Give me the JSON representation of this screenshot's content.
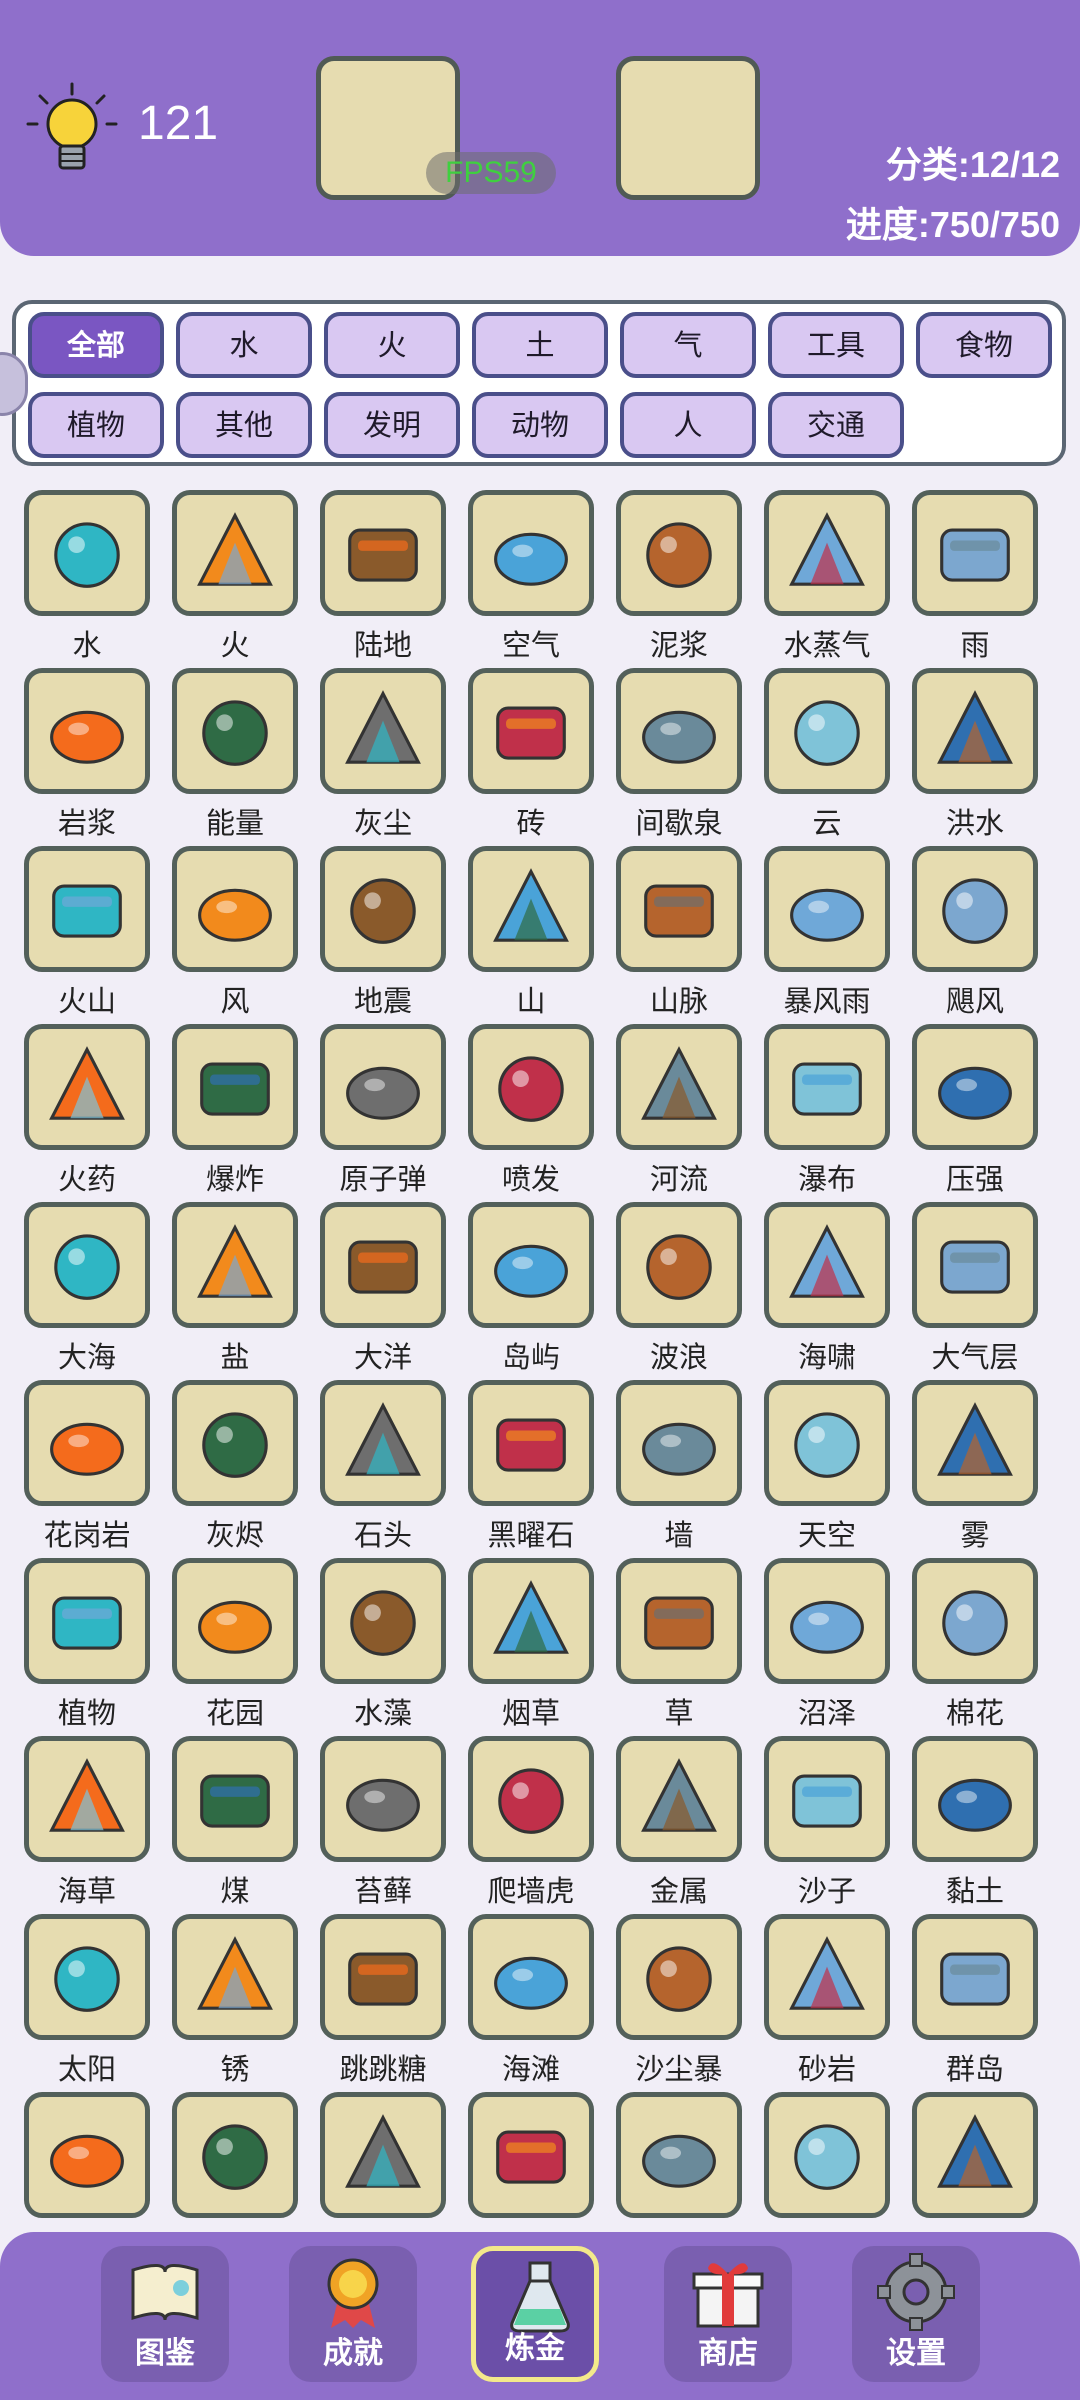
{
  "header": {
    "hint_count": "121",
    "fps": "FPS59",
    "category_stat": "分类:12/12",
    "progress_stat": "进度:750/750"
  },
  "filters": [
    "全部",
    "水",
    "火",
    "土",
    "气",
    "工具",
    "食物",
    "植物",
    "其他",
    "发明",
    "动物",
    "人",
    "交通"
  ],
  "active_filter": "全部",
  "elements": [
    "水",
    "火",
    "陆地",
    "空气",
    "泥浆",
    "水蒸气",
    "雨",
    "岩浆",
    "能量",
    "灰尘",
    "砖",
    "间歇泉",
    "云",
    "洪水",
    "火山",
    "风",
    "地震",
    "山",
    "山脉",
    "暴风雨",
    "飓风",
    "火药",
    "爆炸",
    "原子弹",
    "喷发",
    "河流",
    "瀑布",
    "压强",
    "大海",
    "盐",
    "大洋",
    "岛屿",
    "波浪",
    "海啸",
    "大气层",
    "花岗岩",
    "灰烬",
    "石头",
    "黑曜石",
    "墙",
    "天空",
    "雾",
    "植物",
    "花园",
    "水藻",
    "烟草",
    "草",
    "沼泽",
    "棉花",
    "海草",
    "煤",
    "苔藓",
    "爬墙虎",
    "金属",
    "沙子",
    "黏土",
    "太阳",
    "锈",
    "跳跳糖",
    "海滩",
    "沙尘暴",
    "砂岩",
    "群岛"
  ],
  "nav": [
    "图鉴",
    "成就",
    "炼金",
    "商店",
    "设置"
  ],
  "active_nav": "炼金"
}
